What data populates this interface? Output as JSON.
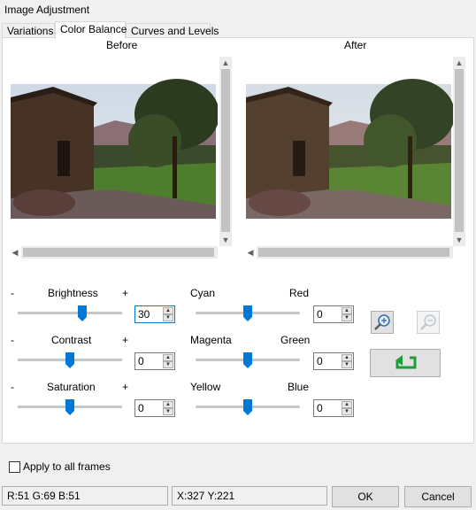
{
  "window": {
    "title": "Image Adjustment"
  },
  "tabs": [
    {
      "label": "Variations"
    },
    {
      "label": "Color Balance"
    },
    {
      "label": "Curves and Levels"
    }
  ],
  "preview": {
    "before_label": "Before",
    "after_label": "After"
  },
  "sliders_left": [
    {
      "minus": "-",
      "label": "Brightness",
      "plus": "+",
      "value": "30",
      "level_pct": 62
    },
    {
      "minus": "-",
      "label": "Contrast",
      "plus": "+",
      "value": "0",
      "level_pct": 50
    },
    {
      "minus": "-",
      "label": "Saturation",
      "plus": "+",
      "value": "0",
      "level_pct": 50
    }
  ],
  "sliders_right": [
    {
      "left_label": "Cyan",
      "right_label": "Red",
      "value": "0",
      "level_pct": 50
    },
    {
      "left_label": "Magenta",
      "right_label": "Green",
      "value": "0",
      "level_pct": 50
    },
    {
      "left_label": "Yellow",
      "right_label": "Blue",
      "value": "0",
      "level_pct": 50
    }
  ],
  "apply_all": {
    "label": "Apply to all frames",
    "checked": false
  },
  "status": {
    "rgb": "R:51 G:69 B:51",
    "xy": "X:327 Y:221"
  },
  "buttons": {
    "ok": "OK",
    "cancel": "Cancel"
  },
  "icons": {
    "zoom_in": "zoom-in-icon",
    "zoom_out": "zoom-out-icon",
    "reset": "reset-arrow-icon"
  },
  "colors": {
    "accent": "#0078d7",
    "reset_green": "#1e9e3a"
  }
}
